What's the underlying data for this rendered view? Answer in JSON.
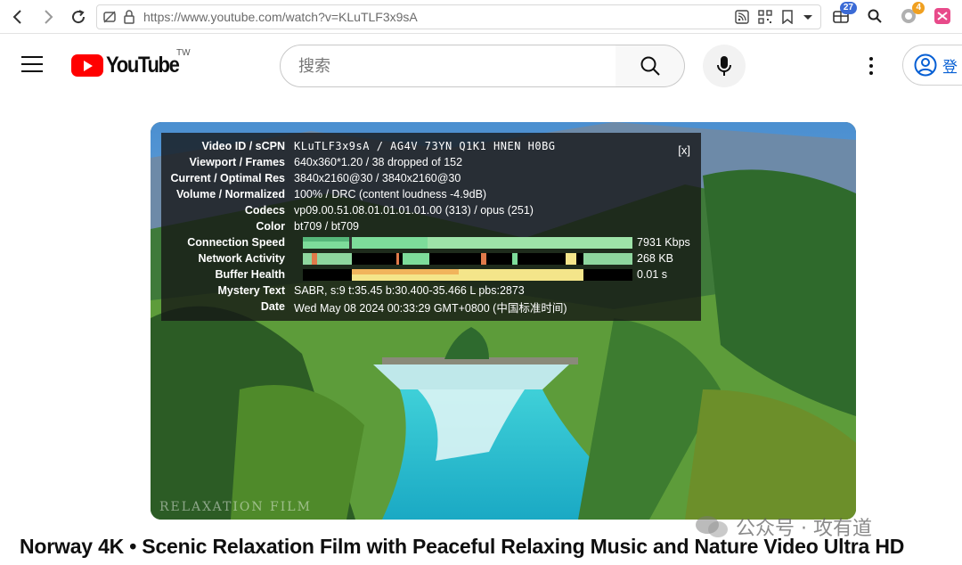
{
  "browser": {
    "url": "https://www.youtube.com/watch?v=KLuTLF3x9sA",
    "extension_badges": [
      "27",
      "4"
    ]
  },
  "header": {
    "logo_text": "YouTube",
    "country_code": "TW",
    "search_placeholder": "搜索",
    "signin_label": "登"
  },
  "stats": {
    "close_label": "[x]",
    "rows": [
      {
        "label": "Video ID / sCPN",
        "value": "KLuTLF3x9sA / AG4V 73YN Q1K1 HNEN H0BG"
      },
      {
        "label": "Viewport / Frames",
        "value": "640x360*1.20 / 38 dropped of 152"
      },
      {
        "label": "Current / Optimal Res",
        "value": "3840x2160@30 / 3840x2160@30"
      },
      {
        "label": "Volume / Normalized",
        "value": "100% / DRC (content loudness -4.9dB)"
      },
      {
        "label": "Codecs",
        "value": "vp09.00.51.08.01.01.01.01.00 (313) / opus (251)"
      },
      {
        "label": "Color",
        "value": "bt709 / bt709"
      },
      {
        "label": "Connection Speed",
        "value": "7931 Kbps"
      },
      {
        "label": "Network Activity",
        "value": "268 KB"
      },
      {
        "label": "Buffer Health",
        "value": "0.01 s"
      },
      {
        "label": "Mystery Text",
        "value": "SABR, s:9 t:35.45 b:30.400-35.466 L pbs:2873"
      },
      {
        "label": "Date",
        "value": "Wed May 08 2024 00:33:29 GMT+0800 (中国标准时间)"
      }
    ]
  },
  "video": {
    "watermark": "RELAXATION FILM"
  },
  "video_title": "Norway 4K • Scenic Relaxation Film with Peaceful Relaxing Music and Nature Video Ultra HD",
  "page_watermark": "公众号 · 攻有道",
  "colors": {
    "brand_red": "#ff0000",
    "link_blue": "#065fd4",
    "graph_green": "#7ddc9a",
    "graph_yellow": "#f4e58a"
  }
}
